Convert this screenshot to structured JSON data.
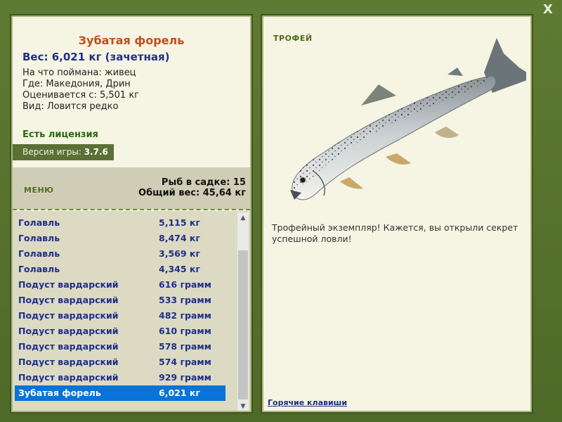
{
  "close_label": "X",
  "fish": {
    "title": "Зубатая форель",
    "weight": "Вес: 6,021 кг (зачетная)",
    "bait": "На что поймана: живец",
    "where": "Где: Македония, Дрин",
    "price": "Оценивается с: 5,501 кг",
    "type": "Вид: Ловится редко"
  },
  "license": "Есть лицензия",
  "version": {
    "label": "Версия игры: ",
    "value": "3.7.6"
  },
  "menu_label": "МЕНЮ",
  "keepnet": {
    "count": "Рыб в садке: 15",
    "total": "Общий вес: 45,64 кг"
  },
  "catch_list": [
    {
      "name": "Голавль",
      "weight": "5,115 кг"
    },
    {
      "name": "Голавль",
      "weight": "8,474 кг"
    },
    {
      "name": "Голавль",
      "weight": "3,569 кг"
    },
    {
      "name": "Голавль",
      "weight": "4,345 кг"
    },
    {
      "name": "Подуст вардарский",
      "weight": "616 грамм"
    },
    {
      "name": "Подуст вардарский",
      "weight": "533 грамм"
    },
    {
      "name": "Подуст вардарский",
      "weight": "482 грамм"
    },
    {
      "name": "Подуст вардарский",
      "weight": "610 грамм"
    },
    {
      "name": "Подуст вардарский",
      "weight": "578 грамм"
    },
    {
      "name": "Подуст вардарский",
      "weight": "574 грамм"
    },
    {
      "name": "Подуст вардарский",
      "weight": "929 грамм"
    },
    {
      "name": "Зубатая форель",
      "weight": "6,021 кг"
    }
  ],
  "selected_index": 11,
  "scroll_icons": {
    "up": "chevron-up-icon",
    "down": "chevron-down-icon"
  },
  "trophy": {
    "label": "ТРОФЕЙ",
    "text": "Трофейный экземпляр! Кажется, вы открыли секрет успешной ловли!"
  },
  "hotkeys": "Горячие клавиши",
  "colors": {
    "frame": "#5a7330",
    "panel": "#f6f4e3",
    "title": "#c0501e",
    "accent_blue": "#1f2f8a",
    "selection": "#0a73d8"
  }
}
